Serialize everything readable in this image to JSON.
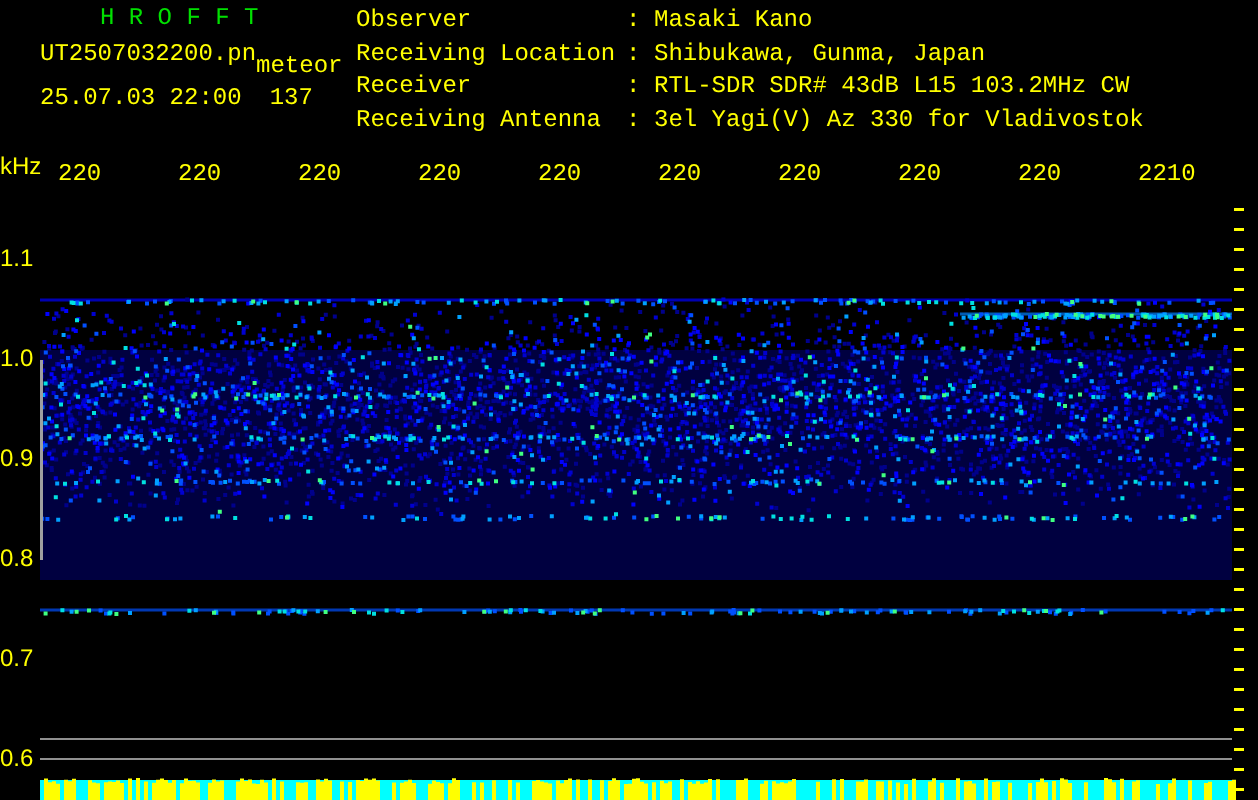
{
  "header": {
    "title": "H R O F F T",
    "file": "UT2507032200.pn",
    "mode": "meteor",
    "datetime": "25.07.03 22:00",
    "count": "137"
  },
  "info": [
    {
      "label": "Observer",
      "separator": ":",
      "value": "Masaki Kano"
    },
    {
      "label": "Receiving Location",
      "separator": ":",
      "value": "Shibukawa, Gunma, Japan"
    },
    {
      "label": "Receiver",
      "separator": ":",
      "value": "RTL-SDR SDR# 43dB L15 103.2MHz CW"
    },
    {
      "label": "Receiving Antenna",
      "separator": ":",
      "value": "3el Yagi(V) Az 330 for Vladivostok"
    }
  ],
  "x_axis": {
    "ticks": [
      "220",
      "220",
      "220",
      "220",
      "220",
      "220",
      "220",
      "220",
      "220",
      "2210"
    ]
  },
  "y_axis": {
    "unit": "kHz",
    "ticks": [
      "1.1",
      "1.0",
      "0.9",
      "0.8",
      "0.7",
      "0.6"
    ]
  }
}
